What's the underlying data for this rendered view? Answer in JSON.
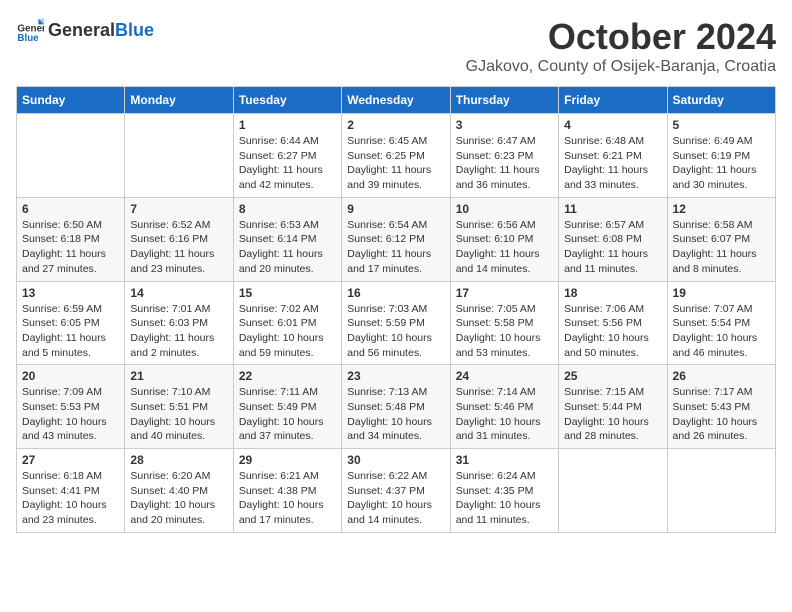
{
  "header": {
    "logo_general": "General",
    "logo_blue": "Blue",
    "month_title": "October 2024",
    "location": "GJakovo, County of Osijek-Baranja, Croatia"
  },
  "days_of_week": [
    "Sunday",
    "Monday",
    "Tuesday",
    "Wednesday",
    "Thursday",
    "Friday",
    "Saturday"
  ],
  "weeks": [
    [
      {
        "day": "",
        "content": ""
      },
      {
        "day": "",
        "content": ""
      },
      {
        "day": "1",
        "content": "Sunrise: 6:44 AM\nSunset: 6:27 PM\nDaylight: 11 hours and 42 minutes."
      },
      {
        "day": "2",
        "content": "Sunrise: 6:45 AM\nSunset: 6:25 PM\nDaylight: 11 hours and 39 minutes."
      },
      {
        "day": "3",
        "content": "Sunrise: 6:47 AM\nSunset: 6:23 PM\nDaylight: 11 hours and 36 minutes."
      },
      {
        "day": "4",
        "content": "Sunrise: 6:48 AM\nSunset: 6:21 PM\nDaylight: 11 hours and 33 minutes."
      },
      {
        "day": "5",
        "content": "Sunrise: 6:49 AM\nSunset: 6:19 PM\nDaylight: 11 hours and 30 minutes."
      }
    ],
    [
      {
        "day": "6",
        "content": "Sunrise: 6:50 AM\nSunset: 6:18 PM\nDaylight: 11 hours and 27 minutes."
      },
      {
        "day": "7",
        "content": "Sunrise: 6:52 AM\nSunset: 6:16 PM\nDaylight: 11 hours and 23 minutes."
      },
      {
        "day": "8",
        "content": "Sunrise: 6:53 AM\nSunset: 6:14 PM\nDaylight: 11 hours and 20 minutes."
      },
      {
        "day": "9",
        "content": "Sunrise: 6:54 AM\nSunset: 6:12 PM\nDaylight: 11 hours and 17 minutes."
      },
      {
        "day": "10",
        "content": "Sunrise: 6:56 AM\nSunset: 6:10 PM\nDaylight: 11 hours and 14 minutes."
      },
      {
        "day": "11",
        "content": "Sunrise: 6:57 AM\nSunset: 6:08 PM\nDaylight: 11 hours and 11 minutes."
      },
      {
        "day": "12",
        "content": "Sunrise: 6:58 AM\nSunset: 6:07 PM\nDaylight: 11 hours and 8 minutes."
      }
    ],
    [
      {
        "day": "13",
        "content": "Sunrise: 6:59 AM\nSunset: 6:05 PM\nDaylight: 11 hours and 5 minutes."
      },
      {
        "day": "14",
        "content": "Sunrise: 7:01 AM\nSunset: 6:03 PM\nDaylight: 11 hours and 2 minutes."
      },
      {
        "day": "15",
        "content": "Sunrise: 7:02 AM\nSunset: 6:01 PM\nDaylight: 10 hours and 59 minutes."
      },
      {
        "day": "16",
        "content": "Sunrise: 7:03 AM\nSunset: 5:59 PM\nDaylight: 10 hours and 56 minutes."
      },
      {
        "day": "17",
        "content": "Sunrise: 7:05 AM\nSunset: 5:58 PM\nDaylight: 10 hours and 53 minutes."
      },
      {
        "day": "18",
        "content": "Sunrise: 7:06 AM\nSunset: 5:56 PM\nDaylight: 10 hours and 50 minutes."
      },
      {
        "day": "19",
        "content": "Sunrise: 7:07 AM\nSunset: 5:54 PM\nDaylight: 10 hours and 46 minutes."
      }
    ],
    [
      {
        "day": "20",
        "content": "Sunrise: 7:09 AM\nSunset: 5:53 PM\nDaylight: 10 hours and 43 minutes."
      },
      {
        "day": "21",
        "content": "Sunrise: 7:10 AM\nSunset: 5:51 PM\nDaylight: 10 hours and 40 minutes."
      },
      {
        "day": "22",
        "content": "Sunrise: 7:11 AM\nSunset: 5:49 PM\nDaylight: 10 hours and 37 minutes."
      },
      {
        "day": "23",
        "content": "Sunrise: 7:13 AM\nSunset: 5:48 PM\nDaylight: 10 hours and 34 minutes."
      },
      {
        "day": "24",
        "content": "Sunrise: 7:14 AM\nSunset: 5:46 PM\nDaylight: 10 hours and 31 minutes."
      },
      {
        "day": "25",
        "content": "Sunrise: 7:15 AM\nSunset: 5:44 PM\nDaylight: 10 hours and 28 minutes."
      },
      {
        "day": "26",
        "content": "Sunrise: 7:17 AM\nSunset: 5:43 PM\nDaylight: 10 hours and 26 minutes."
      }
    ],
    [
      {
        "day": "27",
        "content": "Sunrise: 6:18 AM\nSunset: 4:41 PM\nDaylight: 10 hours and 23 minutes."
      },
      {
        "day": "28",
        "content": "Sunrise: 6:20 AM\nSunset: 4:40 PM\nDaylight: 10 hours and 20 minutes."
      },
      {
        "day": "29",
        "content": "Sunrise: 6:21 AM\nSunset: 4:38 PM\nDaylight: 10 hours and 17 minutes."
      },
      {
        "day": "30",
        "content": "Sunrise: 6:22 AM\nSunset: 4:37 PM\nDaylight: 10 hours and 14 minutes."
      },
      {
        "day": "31",
        "content": "Sunrise: 6:24 AM\nSunset: 4:35 PM\nDaylight: 10 hours and 11 minutes."
      },
      {
        "day": "",
        "content": ""
      },
      {
        "day": "",
        "content": ""
      }
    ]
  ]
}
